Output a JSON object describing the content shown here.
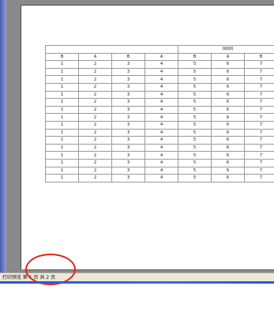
{
  "window": {
    "status_text": "打印预览  第 1 页  共 2 页"
  },
  "sheet": {
    "title": "QQQQ",
    "header": [
      "B",
      "A",
      "B",
      "A",
      "B",
      "A",
      "B"
    ],
    "rows": [
      [
        "1",
        "2",
        "3",
        "4",
        "5",
        "6",
        "7"
      ],
      [
        "1",
        "2",
        "3",
        "4",
        "5",
        "6",
        "7"
      ],
      [
        "1",
        "2",
        "3",
        "4",
        "5",
        "6",
        "7"
      ],
      [
        "1",
        "2",
        "3",
        "4",
        "5",
        "6",
        "7"
      ],
      [
        "1",
        "2",
        "3",
        "4",
        "5",
        "6",
        "7"
      ],
      [
        "1",
        "2",
        "3",
        "4",
        "5",
        "6",
        "7"
      ],
      [
        "1",
        "2",
        "3",
        "4",
        "5",
        "6",
        "7"
      ],
      [
        "1",
        "2",
        "3",
        "4",
        "5",
        "6",
        "7"
      ],
      [
        "1",
        "2",
        "3",
        "4",
        "5",
        "6",
        "7"
      ],
      [
        "1",
        "2",
        "3",
        "4",
        "5",
        "6",
        "7"
      ],
      [
        "1",
        "2",
        "3",
        "4",
        "5",
        "6",
        "7"
      ],
      [
        "1",
        "2",
        "3",
        "4",
        "5",
        "6",
        "7"
      ],
      [
        "1",
        "2",
        "3",
        "4",
        "5",
        "6",
        "7"
      ],
      [
        "1",
        "2",
        "3",
        "4",
        "5",
        "6",
        "7"
      ],
      [
        "1",
        "2",
        "3",
        "4",
        "5",
        "6",
        "7"
      ],
      [
        "1",
        "2",
        "3",
        "4",
        "5",
        "6",
        "7"
      ]
    ]
  },
  "colors": {
    "highlight": "#e8221a",
    "preview_background": "#8a8a8a",
    "statusbar": "#ece9d8"
  }
}
